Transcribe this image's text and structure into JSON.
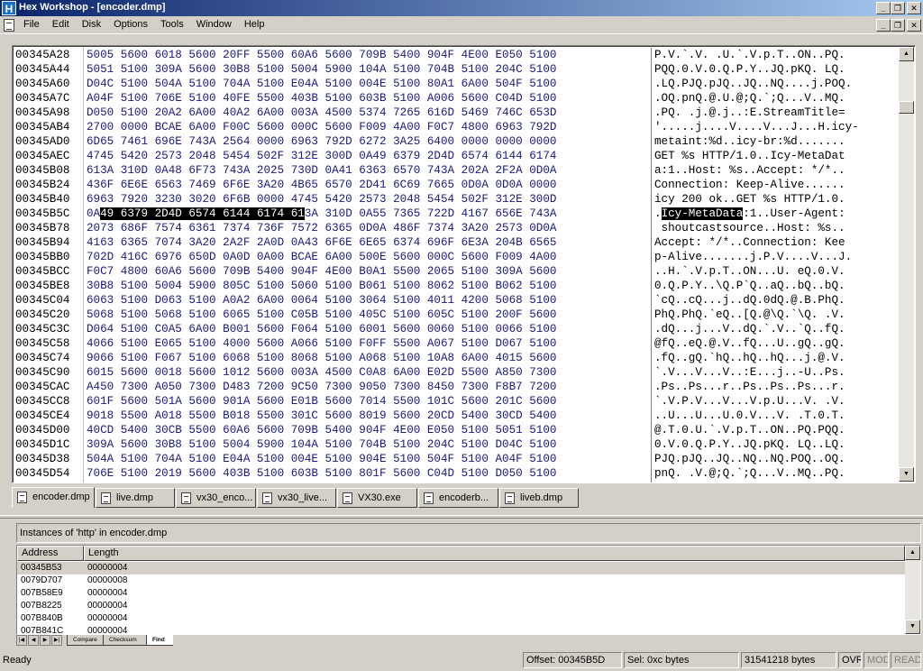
{
  "window": {
    "title": "Hex Workshop - [encoder.dmp]",
    "app_icon_letter": "H",
    "min_glyph": "_",
    "max_glyph": "❐",
    "close_glyph": "✕"
  },
  "menu": [
    "File",
    "Edit",
    "Disk",
    "Options",
    "Tools",
    "Window",
    "Help"
  ],
  "hex_rows": [
    {
      "addr": "00345A28",
      "hex": "5005 5600 6018 5600 20FF 5500 60A6 5600 709B 5400 904F 4E00 E050 5100",
      "ascii": "P.V.`.V. .U.`.V.p.T..ON..PQ."
    },
    {
      "addr": "00345A44",
      "hex": "5051 5100 309A 5600 30B8 5100 5004 5900 104A 5100 704B 5100 204C 5100",
      "ascii": "PQQ.0.V.0.Q.P.Y..JQ.pKQ. LQ."
    },
    {
      "addr": "00345A60",
      "hex": "D04C 5100 504A 5100 704A 5100 E04A 5100 004E 5100 80A1 6A00 504F 5100",
      "ascii": ".LQ.PJQ.pJQ..JQ..NQ....j.POQ."
    },
    {
      "addr": "00345A7C",
      "hex": "A04F 5100 706E 5100 40FE 5500 403B 5100 603B 5100 A006 5600 C04D 5100",
      "ascii": ".OQ.pnQ.@.U.@;Q.`;Q...V..MQ."
    },
    {
      "addr": "00345A98",
      "hex": "D050 5100 20A2 6A00 40A2 6A00 003A 4500 5374 7265 616D 5469 746C 653D",
      "ascii": ".PQ. .j.@.j..:E.StreamTitle="
    },
    {
      "addr": "00345AB4",
      "hex": "2700 0000 BCAE 6A00 F00C 5600 000C 5600 F009 4A00 F0C7 4800 6963 792D",
      "ascii": "'.....j....V....V...J...H.icy-"
    },
    {
      "addr": "00345AD0",
      "hex": "6D65 7461 696E 743A 2564 0000 6963 792D 6272 3A25 6400 0000 0000 0000",
      "ascii": "metaint:%d..icy-br:%d......."
    },
    {
      "addr": "00345AEC",
      "hex": "4745 5420 2573 2048 5454 502F 312E 300D 0A49 6379 2D4D 6574 6144 6174",
      "ascii": "GET %s HTTP/1.0..Icy-MetaDat"
    },
    {
      "addr": "00345B08",
      "hex": "613A 310D 0A48 6F73 743A 2025 730D 0A41 6363 6570 743A 202A 2F2A 0D0A",
      "ascii": "a:1..Host: %s..Accept: */*.."
    },
    {
      "addr": "00345B24",
      "hex": "436F 6E6E 6563 7469 6F6E 3A20 4B65 6570 2D41 6C69 7665 0D0A 0D0A 0000",
      "ascii": "Connection: Keep-Alive......"
    },
    {
      "addr": "00345B40",
      "hex": "6963 7920 3230 3020 6F6B 0000 4745 5420 2573 2048 5454 502F 312E 300D",
      "ascii": "icy 200 ok..GET %s HTTP/1.0."
    },
    {
      "addr": "00345B5C",
      "hex": "0A",
      "hex_hl": "49 6379 2D4D 6574 6144 6174 61",
      "hex_tail": "3A 310D 0A55 7365 722D 4167 656E 743A",
      "ascii": ".",
      "ascii_hl": "Icy-MetaData",
      "ascii_tail": ":1..User-Agent:"
    },
    {
      "addr": "00345B78",
      "hex": "2073 686F 7574 6361 7374 736F 7572 6365 0D0A 486F 7374 3A20 2573 0D0A",
      "ascii": " shoutcastsource..Host: %s.."
    },
    {
      "addr": "00345B94",
      "hex": "4163 6365 7074 3A20 2A2F 2A0D 0A43 6F6E 6E65 6374 696F 6E3A 204B 6565",
      "ascii": "Accept: */*..Connection: Kee"
    },
    {
      "addr": "00345BB0",
      "hex": "702D 416C 6976 650D 0A0D 0A00 BCAE 6A00 500E 5600 000C 5600 F009 4A00",
      "ascii": "p-Alive.......j.P.V....V...J."
    },
    {
      "addr": "00345BCC",
      "hex": "F0C7 4800 60A6 5600 709B 5400 904F 4E00 B0A1 5500 2065 5100 309A 5600",
      "ascii": "..H.`.V.p.T..ON...U. eQ.0.V."
    },
    {
      "addr": "00345BE8",
      "hex": "30B8 5100 5004 5900 805C 5100 5060 5100 B061 5100 8062 5100 B062 5100",
      "ascii": "0.Q.P.Y..\\Q.P`Q..aQ..bQ..bQ."
    },
    {
      "addr": "00345C04",
      "hex": "6063 5100 D063 5100 A0A2 6A00 0064 5100 3064 5100 4011 4200 5068 5100",
      "ascii": "`cQ..cQ...j..dQ.0dQ.@.B.PhQ."
    },
    {
      "addr": "00345C20",
      "hex": "5068 5100 5068 5100 6065 5100 C05B 5100 405C 5100 605C 5100 200F 5600",
      "ascii": "PhQ.PhQ.`eQ..[Q.@\\Q.`\\Q. .V."
    },
    {
      "addr": "00345C3C",
      "hex": "D064 5100 C0A5 6A00 B001 5600 F064 5100 6001 5600 0060 5100 0066 5100",
      "ascii": ".dQ...j...V..dQ.`.V..`Q..fQ."
    },
    {
      "addr": "00345C58",
      "hex": "4066 5100 E065 5100 4000 5600 A066 5100 F0FF 5500 A067 5100 D067 5100",
      "ascii": "@fQ..eQ.@.V..fQ...U..gQ..gQ."
    },
    {
      "addr": "00345C74",
      "hex": "9066 5100 F067 5100 6068 5100 8068 5100 A068 5100 10A8 6A00 4015 5600",
      "ascii": ".fQ..gQ.`hQ..hQ..hQ...j.@.V."
    },
    {
      "addr": "00345C90",
      "hex": "6015 5600 0018 5600 1012 5600 003A 4500 C0A8 6A00 E02D 5500 A850 7300",
      "ascii": "`.V...V...V..:E...j..-U..Ps."
    },
    {
      "addr": "00345CAC",
      "hex": "A450 7300 A050 7300 D483 7200 9C50 7300 9050 7300 8450 7300 F8B7 7200",
      "ascii": ".Ps..Ps...r..Ps..Ps..Ps...r."
    },
    {
      "addr": "00345CC8",
      "hex": "601F 5600 501A 5600 901A 5600 E01B 5600 7014 5500 101C 5600 201C 5600",
      "ascii": "`.V.P.V...V...V.p.U...V. .V."
    },
    {
      "addr": "00345CE4",
      "hex": "9018 5500 A018 5500 B018 5500 301C 5600 8019 5600 20CD 5400 30CD 5400",
      "ascii": "..U...U...U.0.V...V. .T.0.T."
    },
    {
      "addr": "00345D00",
      "hex": "40CD 5400 30CB 5500 60A6 5600 709B 5400 904F 4E00 E050 5100 5051 5100",
      "ascii": "@.T.0.U.`.V.p.T..ON..PQ.PQQ."
    },
    {
      "addr": "00345D1C",
      "hex": "309A 5600 30B8 5100 5004 5900 104A 5100 704B 5100 204C 5100 D04C 5100",
      "ascii": "0.V.0.Q.P.Y..JQ.pKQ. LQ..LQ."
    },
    {
      "addr": "00345D38",
      "hex": "504A 5100 704A 5100 E04A 5100 004E 5100 904E 5100 504F 5100 A04F 5100",
      "ascii": "PJQ.pJQ..JQ..NQ..NQ.POQ..OQ."
    },
    {
      "addr": "00345D54",
      "hex": "706E 5100 2019 5600 403B 5100 603B 5100 801F 5600 C04D 5100 D050 5100",
      "ascii": "pnQ. .V.@;Q.`;Q...V..MQ..PQ."
    }
  ],
  "file_tabs": [
    "encoder.dmp",
    "live.dmp",
    "vx30_enco...",
    "vx30_live...",
    "VX30.exe",
    "encoderb...",
    "liveb.dmp"
  ],
  "results": {
    "title": "Instances of 'http' in encoder.dmp",
    "columns": [
      "Address",
      "Length"
    ],
    "rows": [
      {
        "address": "00345B53",
        "length": "00000004"
      },
      {
        "address": "0079D707",
        "length": "00000008"
      },
      {
        "address": "007B58E9",
        "length": "00000004"
      },
      {
        "address": "007B8225",
        "length": "00000004"
      },
      {
        "address": "007B840B",
        "length": "00000004"
      },
      {
        "address": "007B841C",
        "length": "00000004"
      }
    ],
    "tabs": [
      "Compare",
      "Checksum",
      "Find"
    ],
    "nav_glyphs": [
      "|◀",
      "◀",
      "▶",
      "▶|"
    ]
  },
  "status": {
    "ready": "Ready",
    "offset": "Offset: 00345B5D",
    "sel": "Sel: 0xc bytes",
    "size": "31541218 bytes",
    "ovr": "OVR",
    "mod": "MOD",
    "read": "READ"
  }
}
